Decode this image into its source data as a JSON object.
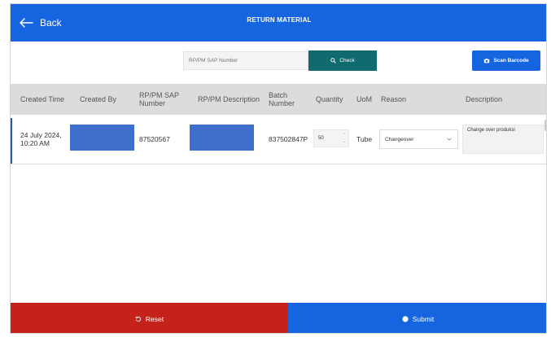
{
  "header": {
    "back_label": "Back",
    "title": "RETURN MATERIAL",
    "color": "#1565e0"
  },
  "search": {
    "placeholder": "RP/PM SAP Number",
    "value": "",
    "check_label": "Check",
    "check_icon": "search-icon",
    "scan_label": "Scan Barcode",
    "scan_icon": "camera-icon"
  },
  "table": {
    "columns": [
      "Created Time",
      "Created By",
      "RP/PM SAP Number",
      "RP/PM Description",
      "Batch Number",
      "Quantity",
      "UoM",
      "Reason",
      "Description"
    ],
    "rows": [
      {
        "created_time": "24 July 2024, 10:20 AM",
        "created_by": "",
        "sap_number": "87520567",
        "description_material": "",
        "batch_number": "837502847P",
        "quantity": "50",
        "uom": "Tube",
        "reason": "Changeover",
        "description": "Change over produksi"
      }
    ]
  },
  "footer": {
    "reset_label": "Reset",
    "reset_icon": "reset-icon",
    "reset_color": "#c4221a",
    "submit_label": "Submit",
    "submit_icon": "submit-dot-icon",
    "submit_color": "#1565e0"
  }
}
